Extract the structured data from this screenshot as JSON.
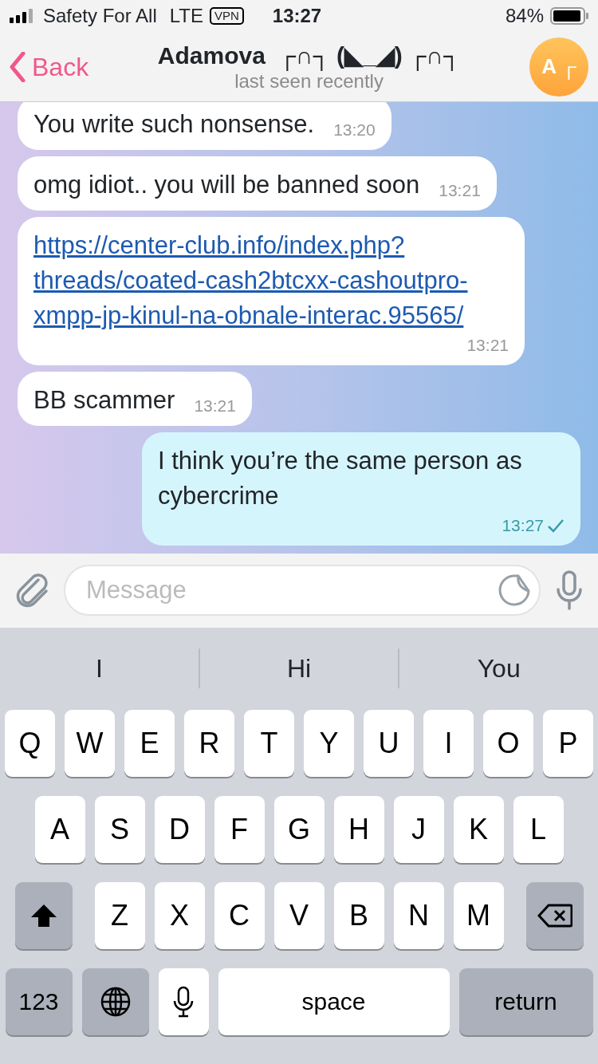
{
  "status_bar": {
    "carrier": "Safety For All",
    "network": "LTE",
    "vpn": "VPN",
    "time": "13:27",
    "battery": "84%"
  },
  "header": {
    "back": "Back",
    "title": "Adamova  ┌∩┐ (◣_◢) ┌∩┐",
    "subtitle": "last seen recently",
    "avatar": "A ┌"
  },
  "messages": [
    {
      "kind": "text",
      "outgoing": false,
      "text": "You write such nonsense.",
      "time": "13:20"
    },
    {
      "kind": "text",
      "outgoing": false,
      "text": "omg idiot.. you will be banned soon",
      "time": "13:21"
    },
    {
      "kind": "link",
      "outgoing": false,
      "text": "https://center-club.info/index.php?threads/coated-cash2btcxx-cashoutpro-xmpp-jp-kinul-na-obnale-interac.95565/",
      "time": "13:21"
    },
    {
      "kind": "text",
      "outgoing": false,
      "text": "BB scammer",
      "time": "13:21"
    },
    {
      "kind": "text",
      "outgoing": true,
      "text": "I think you’re the same person as cybercrime",
      "time": "13:27",
      "delivered": true
    }
  ],
  "composer": {
    "placeholder": "Message"
  },
  "suggestions": [
    "I",
    "Hi",
    "You"
  ],
  "keyboard": [
    [
      {
        "kind": "letter",
        "label": "Q"
      },
      {
        "kind": "letter",
        "label": "W"
      },
      {
        "kind": "letter",
        "label": "E"
      },
      {
        "kind": "letter",
        "label": "R"
      },
      {
        "kind": "letter",
        "label": "T"
      },
      {
        "kind": "letter",
        "label": "Y"
      },
      {
        "kind": "letter",
        "label": "U"
      },
      {
        "kind": "letter",
        "label": "I"
      },
      {
        "kind": "letter",
        "label": "O"
      },
      {
        "kind": "letter",
        "label": "P"
      }
    ],
    [
      {
        "kind": "letter",
        "label": "A"
      },
      {
        "kind": "letter",
        "label": "S"
      },
      {
        "kind": "letter",
        "label": "D"
      },
      {
        "kind": "letter",
        "label": "F"
      },
      {
        "kind": "letter",
        "label": "G"
      },
      {
        "kind": "letter",
        "label": "H"
      },
      {
        "kind": "letter",
        "label": "J"
      },
      {
        "kind": "letter",
        "label": "K"
      },
      {
        "kind": "letter",
        "label": "L"
      }
    ],
    [
      {
        "kind": "shift"
      },
      {
        "kind": "letter",
        "label": "Z"
      },
      {
        "kind": "letter",
        "label": "X"
      },
      {
        "kind": "letter",
        "label": "C"
      },
      {
        "kind": "letter",
        "label": "V"
      },
      {
        "kind": "letter",
        "label": "B"
      },
      {
        "kind": "letter",
        "label": "N"
      },
      {
        "kind": "letter",
        "label": "M"
      },
      {
        "kind": "backspace"
      }
    ],
    [
      {
        "kind": "numbers",
        "label": "123"
      },
      {
        "kind": "globe"
      },
      {
        "kind": "mic"
      },
      {
        "kind": "space",
        "label": "space"
      },
      {
        "kind": "return",
        "label": "return"
      }
    ]
  ]
}
